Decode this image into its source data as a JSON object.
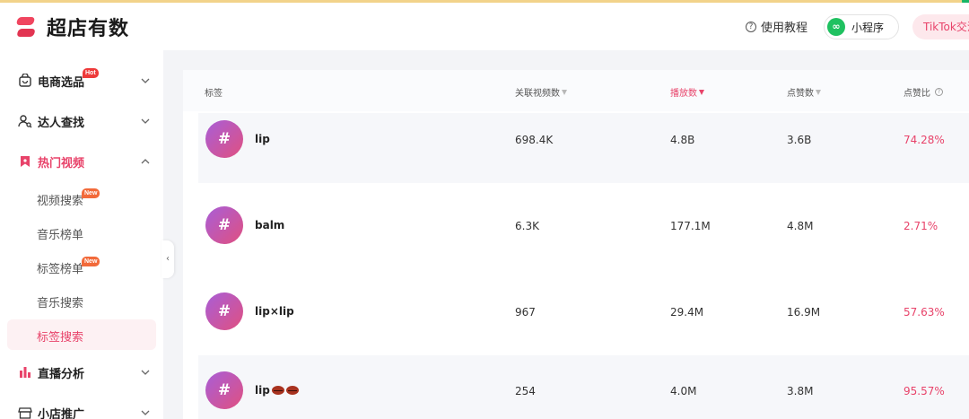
{
  "header": {
    "logo_text": "超店有数",
    "tutorial_label": "使用教程",
    "mini_program_label": "小程序",
    "tiktok_label": "TikTok交流"
  },
  "sidebar": {
    "menus": [
      {
        "label": "电商选品",
        "icon": "shopping-bag-icon",
        "badge": "Hot"
      },
      {
        "label": "达人查找",
        "icon": "user-search-icon"
      },
      {
        "label": "热门视频",
        "icon": "bookmark-icon",
        "active": true,
        "children": [
          {
            "label": "视频搜索",
            "badge": "New"
          },
          {
            "label": "音乐榜单"
          },
          {
            "label": "标签榜单",
            "badge": "New"
          },
          {
            "label": "音乐搜索"
          },
          {
            "label": "标签搜索",
            "selected": true
          }
        ]
      },
      {
        "label": "直播分析",
        "icon": "bar-chart-icon"
      },
      {
        "label": "小店推广",
        "icon": "store-icon"
      }
    ]
  },
  "table": {
    "headers": {
      "tag": "标签",
      "related_videos": "关联视频数",
      "plays": "播放数",
      "likes": "点赞数",
      "like_ratio": "点赞比"
    },
    "sorted_column": "plays",
    "rows": [
      {
        "tag": "lip",
        "related_videos": "698.4K",
        "plays": "4.8B",
        "likes": "3.6B",
        "like_ratio": "74.28%"
      },
      {
        "tag": "balm",
        "related_videos": "6.3K",
        "plays": "177.1M",
        "likes": "4.8M",
        "like_ratio": "2.71%"
      },
      {
        "tag": "lip×lip",
        "related_videos": "967",
        "plays": "29.4M",
        "likes": "16.9M",
        "like_ratio": "57.63%"
      },
      {
        "tag": "lip",
        "tag_emoji": "lips-emoji",
        "related_videos": "254",
        "plays": "4.0M",
        "likes": "3.8M",
        "like_ratio": "95.57%"
      }
    ]
  },
  "colors": {
    "accent": "#e8436a",
    "hashtag_gradient_start": "#a85ed8",
    "hashtag_gradient_end": "#e05080",
    "wechat_green": "#1fc160"
  }
}
